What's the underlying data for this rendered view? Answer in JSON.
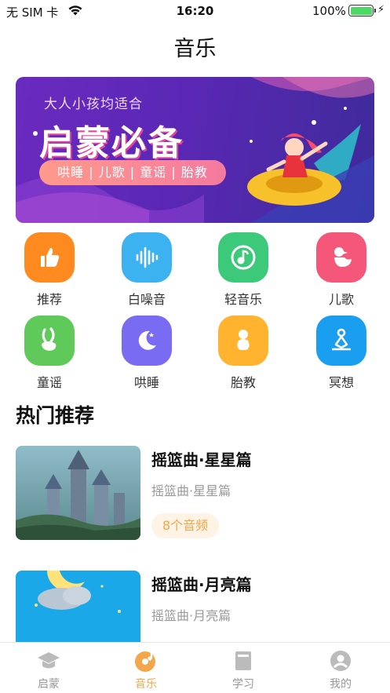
{
  "status": {
    "carrier": "无 SIM 卡",
    "time": "16:20",
    "battery": "100%"
  },
  "nav": {
    "title": "音乐"
  },
  "banner": {
    "tagline": "大人小孩均适合",
    "headline": "启蒙必备",
    "chips": "哄睡 | 儿歌 | 童谣 | 胎教"
  },
  "categories": [
    {
      "label": "推荐",
      "icon": "thumbs-up-icon",
      "color": "#ff8a1f"
    },
    {
      "label": "白噪音",
      "icon": "sound-wave-icon",
      "color": "#3db2f0"
    },
    {
      "label": "轻音乐",
      "icon": "music-note-icon",
      "color": "#3cc97a"
    },
    {
      "label": "儿歌",
      "icon": "duck-icon",
      "color": "#f5577a"
    },
    {
      "label": "童谣",
      "icon": "rabbit-icon",
      "color": "#5fc95a"
    },
    {
      "label": "哄睡",
      "icon": "moon-icon",
      "color": "#7a6cf2"
    },
    {
      "label": "胎教",
      "icon": "baby-icon",
      "color": "#ffb32e"
    },
    {
      "label": "冥想",
      "icon": "meditation-icon",
      "color": "#1a9ef0"
    }
  ],
  "section": {
    "title": "热门推荐"
  },
  "cards": [
    {
      "title": "摇篮曲·星星篇",
      "subtitle": "摇篮曲·星星篇",
      "badge": "8个音频"
    },
    {
      "title": "摇篮曲·月亮篇",
      "subtitle": "摇篮曲·月亮篇",
      "badge": ""
    }
  ],
  "tabs": [
    {
      "label": "启蒙",
      "icon": "graduation-cap-icon",
      "active": false
    },
    {
      "label": "音乐",
      "icon": "music-disc-icon",
      "active": true
    },
    {
      "label": "学习",
      "icon": "book-icon",
      "active": false
    },
    {
      "label": "我的",
      "icon": "profile-icon",
      "active": false
    }
  ],
  "colors": {
    "accent": "#f4a64a",
    "badge_bg": "#fff3e6"
  }
}
